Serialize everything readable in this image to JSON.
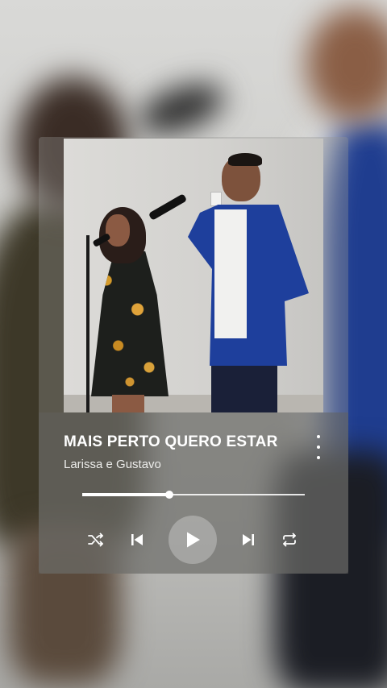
{
  "song": {
    "title": "MAIS PERTO QUERO ESTAR",
    "artist": "Larissa e Gustavo"
  },
  "player": {
    "progress_fraction": 0.39,
    "controls": {
      "shuffle_icon": "shuffle-icon",
      "previous_icon": "skip-previous-icon",
      "play_icon": "play-icon",
      "next_icon": "skip-next-icon",
      "repeat_icon": "repeat-icon",
      "more_icon": "more-vertical-icon"
    }
  },
  "colors": {
    "text": "#ffffff",
    "jacket_blue": "#1e3f9c",
    "panel": "#60605c"
  }
}
